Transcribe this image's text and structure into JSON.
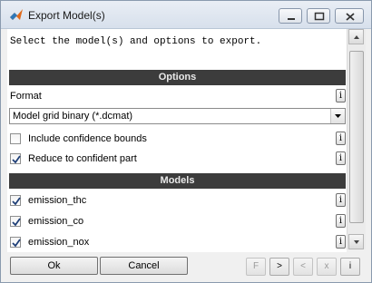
{
  "window": {
    "title": "Export Model(s)",
    "controls": {
      "minimize": "minimize",
      "maximize": "maximize",
      "close": "close"
    }
  },
  "instruction": "Select the model(s) and options to export.",
  "options_section": {
    "header": "Options",
    "format_label": "Format",
    "format_value": "Model grid binary (*.dcmat)",
    "checkboxes": [
      {
        "label": "Include confidence bounds",
        "checked": false
      },
      {
        "label": "Reduce to confident part",
        "checked": true
      }
    ]
  },
  "models_section": {
    "header": "Models",
    "items": [
      {
        "label": "emission_thc",
        "checked": true
      },
      {
        "label": "emission_co",
        "checked": true
      },
      {
        "label": "emission_nox",
        "checked": true
      }
    ]
  },
  "info_glyph": "i",
  "buttons": {
    "ok": "Ok",
    "cancel": "Cancel",
    "nav": [
      "F",
      ">",
      "<",
      "x",
      "i"
    ]
  },
  "colors": {
    "section_bar": "#3c3c3c",
    "title_bar": "#d7e0ec",
    "close_button": "#c94a3b"
  },
  "icons": [
    "matlab-icon",
    "minimize-icon",
    "maximize-icon",
    "close-icon",
    "dropdown-arrow-icon",
    "check-icon",
    "info-icon"
  ]
}
